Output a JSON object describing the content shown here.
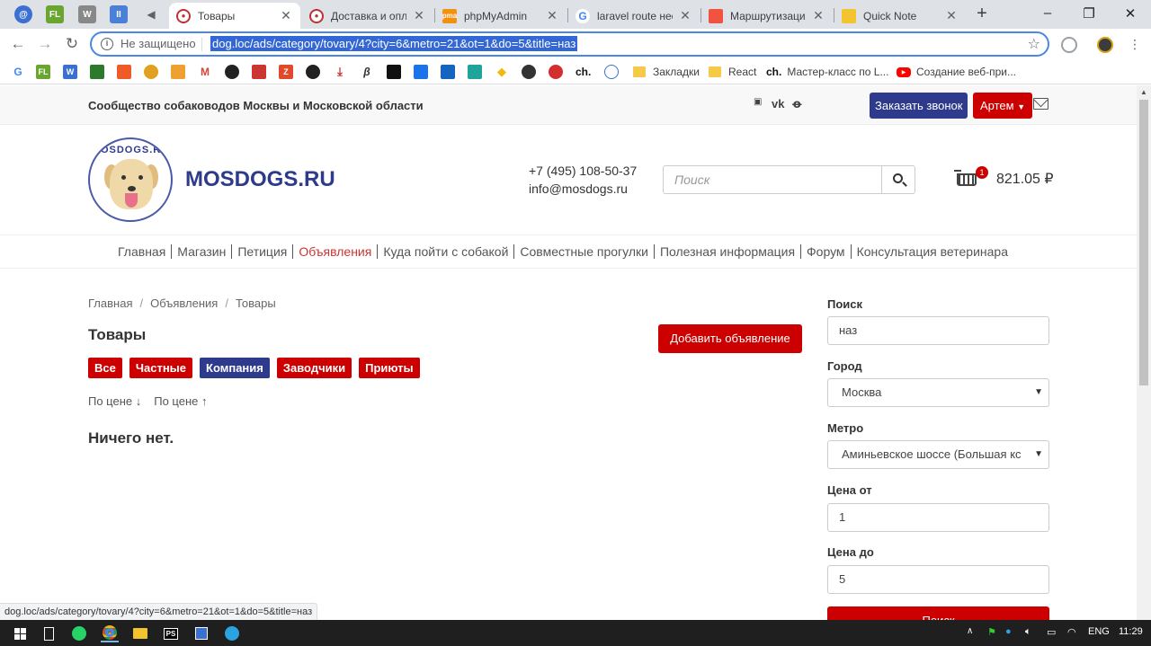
{
  "browser": {
    "pinned_tabs": [
      {
        "name": "pinned-tab-1",
        "glyph": "@",
        "color": "#3b6fd1"
      },
      {
        "name": "pinned-tab-fl",
        "glyph": "FL",
        "color": "#6aa530"
      },
      {
        "name": "pinned-tab-w",
        "glyph": "W",
        "color": "#888888"
      },
      {
        "name": "pinned-tab-pause",
        "glyph": "II",
        "color": "#4a80d6"
      }
    ],
    "tabs": [
      {
        "title": "Товары",
        "active": true
      },
      {
        "title": "Доставка и опла",
        "active": false
      },
      {
        "title": "phpMyAdmin",
        "active": false
      },
      {
        "title": "laravel route нео",
        "active": false
      },
      {
        "title": "Маршрутизация",
        "active": false
      },
      {
        "title": "Quick Note",
        "active": false
      }
    ],
    "omnibox": {
      "security": "Не защищено",
      "url": "dog.loc/ads/category/tovary/4?city=6&metro=21&ot=1&do=5&title=наз"
    },
    "bookmarks": [
      {
        "label": "Закладки"
      },
      {
        "label": "React"
      },
      {
        "label": "Мастер-класс по L..."
      },
      {
        "label": "Создание веб-при..."
      }
    ],
    "status_url": "dog.loc/ads/category/tovary/4?city=6&metro=21&ot=1&do=5&title=наз"
  },
  "site": {
    "community": "Сообщество собаководов Москвы и Московской области",
    "call_button": "Заказать звонок",
    "user_button": "Артем",
    "brand": "MOSDOGS.RU",
    "logo_text": "MOSDOGS.RU",
    "phone": "+7 (495) 108-50-37",
    "email": "info@mosdogs.ru",
    "search_placeholder": "Поиск",
    "cart_count": "1",
    "cart_total": "821.05 ₽",
    "nav": [
      {
        "label": "Главная",
        "active": false
      },
      {
        "label": "Магазин",
        "active": false
      },
      {
        "label": "Петиция",
        "active": false
      },
      {
        "label": "Объявления",
        "active": true
      },
      {
        "label": "Куда пойти с собакой",
        "active": false
      },
      {
        "label": "Совместные прогулки",
        "active": false
      },
      {
        "label": "Полезная информация",
        "active": false
      },
      {
        "label": "Форум",
        "active": false
      },
      {
        "label": "Консультация ветеринара",
        "active": false
      }
    ],
    "breadcrumb": [
      "Главная",
      "Объявления",
      "Товары"
    ],
    "title": "Товары",
    "add_button": "Добавить объявление",
    "filters": [
      {
        "label": "Все",
        "selected": false
      },
      {
        "label": "Частные",
        "selected": false
      },
      {
        "label": "Компания",
        "selected": true
      },
      {
        "label": "Заводчики",
        "selected": false
      },
      {
        "label": "Приюты",
        "selected": false
      }
    ],
    "sort_desc": "По цене",
    "sort_asc": "По цене",
    "empty_message": "Ничего нет.",
    "sidebar": {
      "search_label": "Поиск",
      "search_value": "наз",
      "city_label": "Город",
      "city_value": "Москва",
      "metro_label": "Метро",
      "metro_value": "Аминьевское шоссе (Большая кс",
      "price_from_label": "Цена от",
      "price_from_value": "1",
      "price_to_label": "Цена до",
      "price_to_value": "5",
      "submit_label": "Поиск"
    }
  },
  "taskbar": {
    "lang": "ENG",
    "time": "11:29"
  },
  "colors": {
    "brand_blue": "#2e3a8c",
    "accent_red": "#cc0000",
    "active_nav": "#cc3333"
  }
}
